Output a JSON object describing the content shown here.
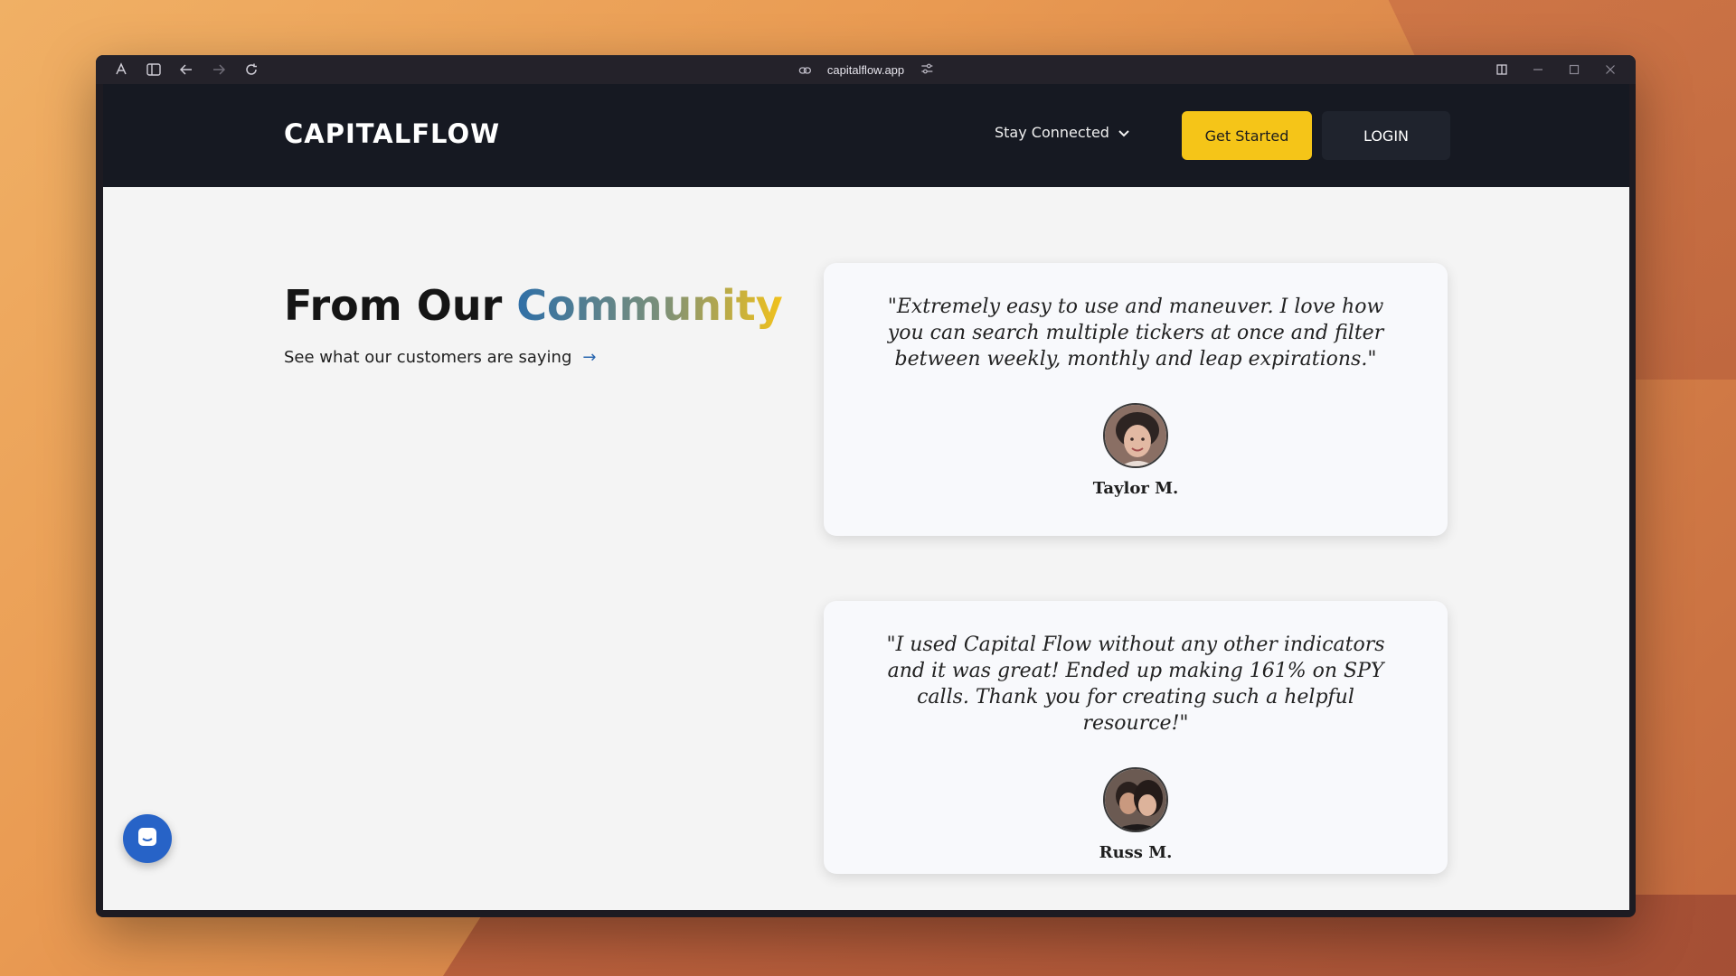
{
  "browser": {
    "url": "capitalflow.app"
  },
  "site": {
    "logo": "CAPITALFLOW",
    "nav": {
      "dropdown_label": "Stay Connected",
      "primary_button": "Get Started",
      "login_button": "LOGIN"
    }
  },
  "section": {
    "heading_prefix": "From Our",
    "heading_accent": "Community",
    "subheading": "See what our customers are saying",
    "arrow": "→"
  },
  "testimonials": [
    {
      "quote": "\"Extremely easy to use and maneuver. I love how you can search multiple tickers at once and filter between weekly, monthly and leap expirations.\"",
      "name": "Taylor M."
    },
    {
      "quote": "\"I used Capital Flow without any other indicators and it was great! Ended up making 161% on SPY calls. Thank you for creating such a helpful resource!\"",
      "name": "Russ M."
    }
  ],
  "colors": {
    "nav_bg": "#161922",
    "primary": "#f5c518",
    "accent_blue": "#2f6fa7",
    "accent_gold": "#f2c21c",
    "chat": "#2763c7"
  },
  "icons": {
    "extension": "extension-icon",
    "sidebar": "sidebar-icon",
    "back": "back-arrow-icon",
    "forward": "forward-arrow-icon",
    "reload": "reload-icon",
    "link": "link-icon",
    "tune": "tune-icon",
    "split": "split-view-icon",
    "chat": "chat-icon"
  }
}
